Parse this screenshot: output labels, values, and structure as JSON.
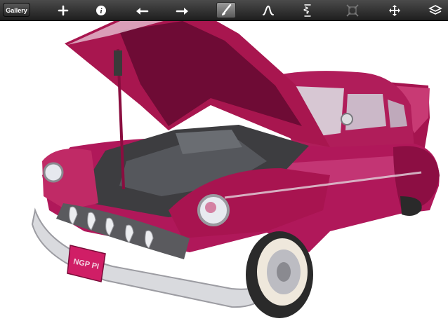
{
  "toolbar": {
    "gallery_label": "Gallery",
    "tools": [
      {
        "icon": "plus-icon"
      },
      {
        "icon": "info-icon"
      },
      {
        "icon": "undo-icon"
      },
      {
        "icon": "redo-icon"
      },
      {
        "icon": "brush-icon",
        "active": true
      },
      {
        "icon": "smudge-icon"
      },
      {
        "icon": "eraser-icon"
      },
      {
        "icon": "transform-icon"
      },
      {
        "icon": "move-icon"
      },
      {
        "icon": "layers-icon"
      }
    ]
  },
  "canvas": {
    "subject": "painting of vintage car with hood open",
    "license_plate": "NGP PI",
    "colors": {
      "body": "#b0185a",
      "body_dark": "#6e0b35",
      "chrome": "#d8d8dc",
      "tire": "#2a2a2a",
      "whitewall": "#efe8dc"
    }
  }
}
